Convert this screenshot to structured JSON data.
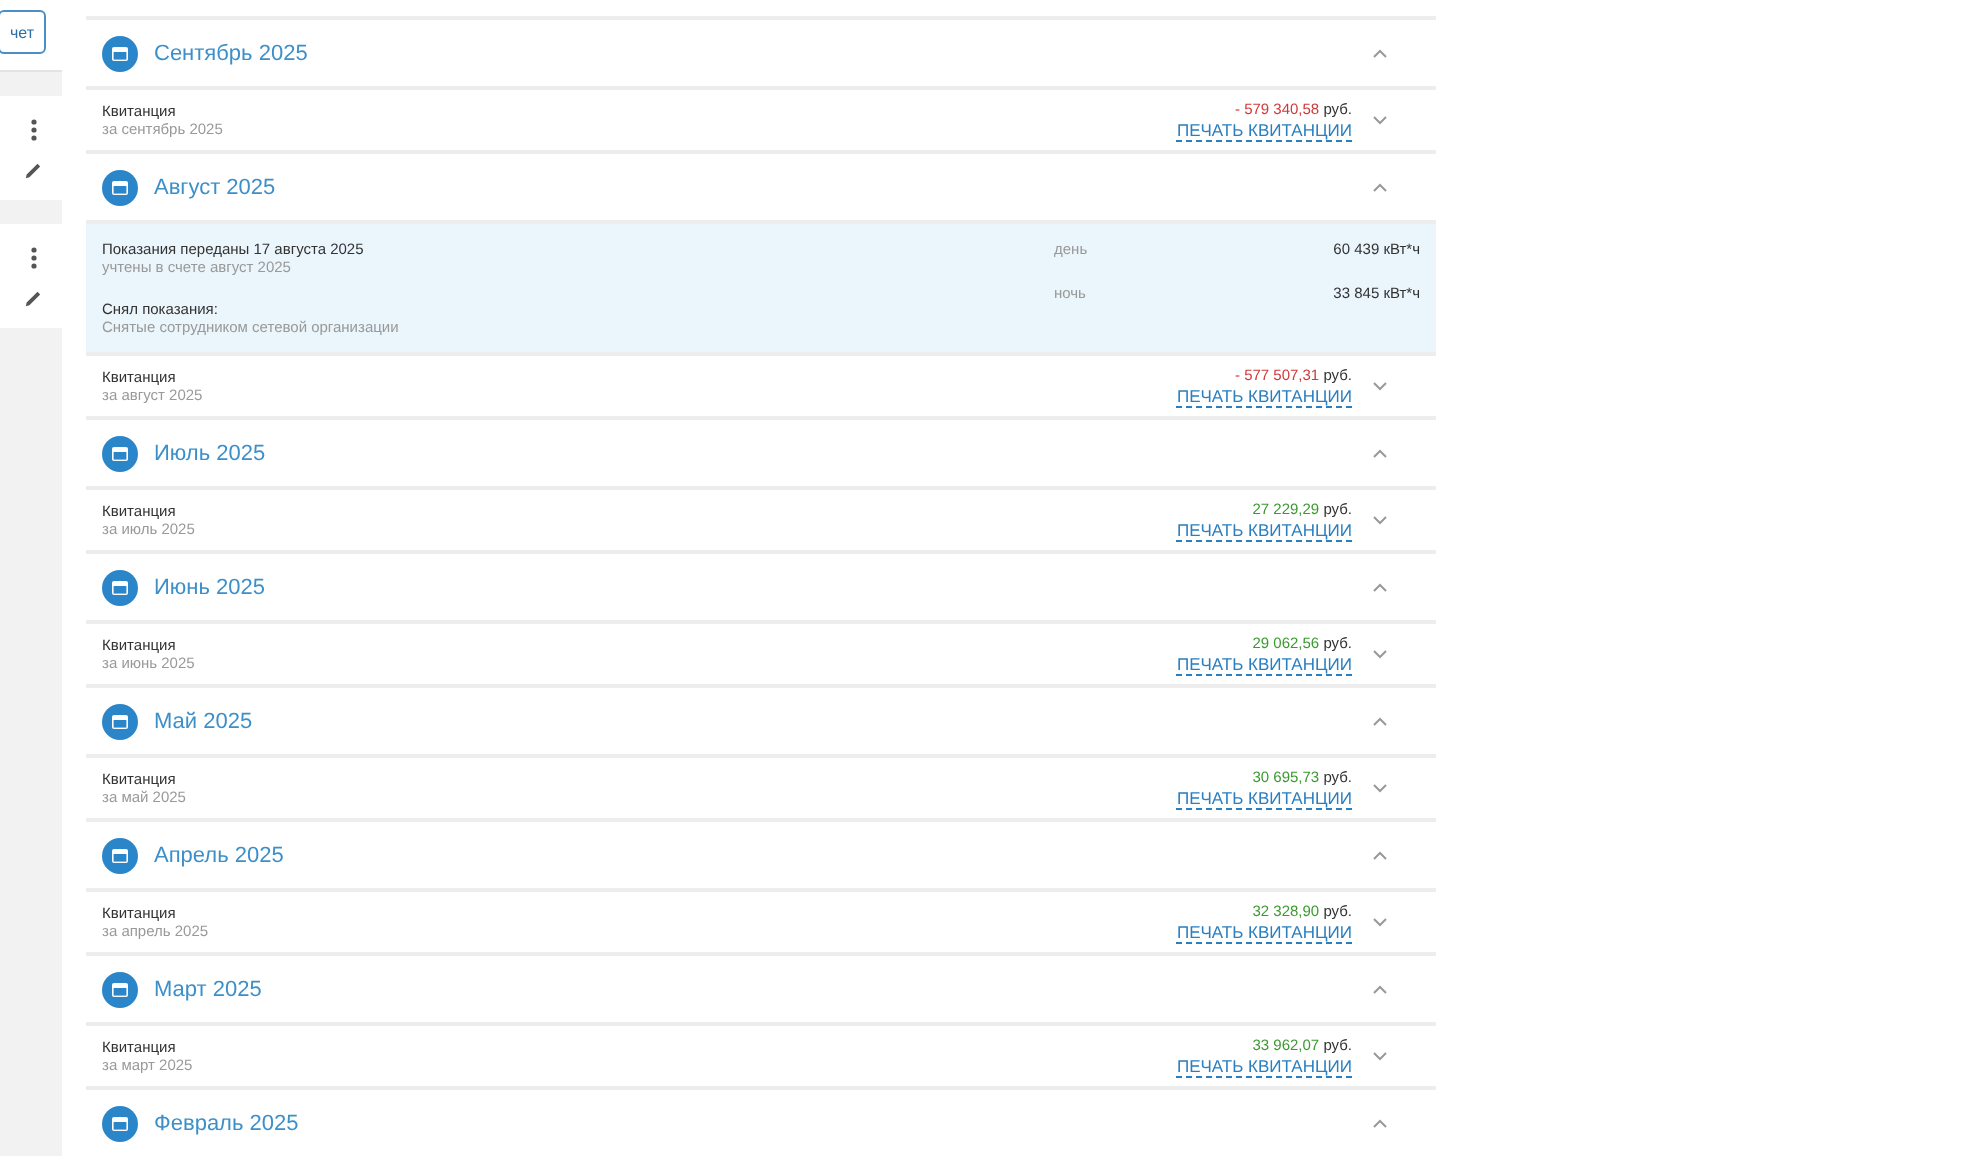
{
  "sidebar": {
    "button": "чет",
    "rows": [
      {
        "kind": "actions"
      },
      {
        "kind": "actions"
      }
    ]
  },
  "months": [
    {
      "title": "Сентябрь 2025",
      "expanded": true,
      "receipt": {
        "label": "Квитанция",
        "period": "за сентябрь 2025",
        "amount": "- 579 340,58",
        "currency": "руб.",
        "debt": true,
        "print": "ПЕЧАТЬ КВИТАНЦИИ",
        "expanded": false
      }
    },
    {
      "title": "Август 2025",
      "expanded": true,
      "readings": {
        "title": "Показания переданы 17 августа 2025",
        "note": "учтены в счете август 2025",
        "taker_label": "Снял показания:",
        "taker": "Снятые сотрудником сетевой организации",
        "values": [
          {
            "zone": "день",
            "value": "60 439 кВт*ч"
          },
          {
            "zone": "ночь",
            "value": "33 845 кВт*ч"
          }
        ]
      },
      "receipt": {
        "label": "Квитанция",
        "period": "за август 2025",
        "amount": "- 577 507,31",
        "currency": "руб.",
        "debt": true,
        "print": "ПЕЧАТЬ КВИТАНЦИИ",
        "expanded": false
      }
    },
    {
      "title": "Июль 2025",
      "expanded": true,
      "receipt": {
        "label": "Квитанция",
        "period": "за июль 2025",
        "amount": "27 229,29",
        "currency": "руб.",
        "debt": false,
        "print": "ПЕЧАТЬ КВИТАНЦИИ",
        "expanded": false
      }
    },
    {
      "title": "Июнь 2025",
      "expanded": true,
      "receipt": {
        "label": "Квитанция",
        "period": "за июнь 2025",
        "amount": "29 062,56",
        "currency": "руб.",
        "debt": false,
        "print": "ПЕЧАТЬ КВИТАНЦИИ",
        "expanded": false
      }
    },
    {
      "title": "Май 2025",
      "expanded": true,
      "receipt": {
        "label": "Квитанция",
        "period": "за май 2025",
        "amount": "30 695,73",
        "currency": "руб.",
        "debt": false,
        "print": "ПЕЧАТЬ КВИТАНЦИИ",
        "expanded": false
      }
    },
    {
      "title": "Апрель 2025",
      "expanded": true,
      "receipt": {
        "label": "Квитанция",
        "period": "за апрель 2025",
        "amount": "32 328,90",
        "currency": "руб.",
        "debt": false,
        "print": "ПЕЧАТЬ КВИТАНЦИИ",
        "expanded": false
      }
    },
    {
      "title": "Март 2025",
      "expanded": true,
      "receipt": {
        "label": "Квитанция",
        "period": "за март 2025",
        "amount": "33 962,07",
        "currency": "руб.",
        "debt": false,
        "print": "ПЕЧАТЬ КВИТАНЦИИ",
        "expanded": false
      }
    },
    {
      "title": "Февраль 2025",
      "expanded": true
    }
  ]
}
